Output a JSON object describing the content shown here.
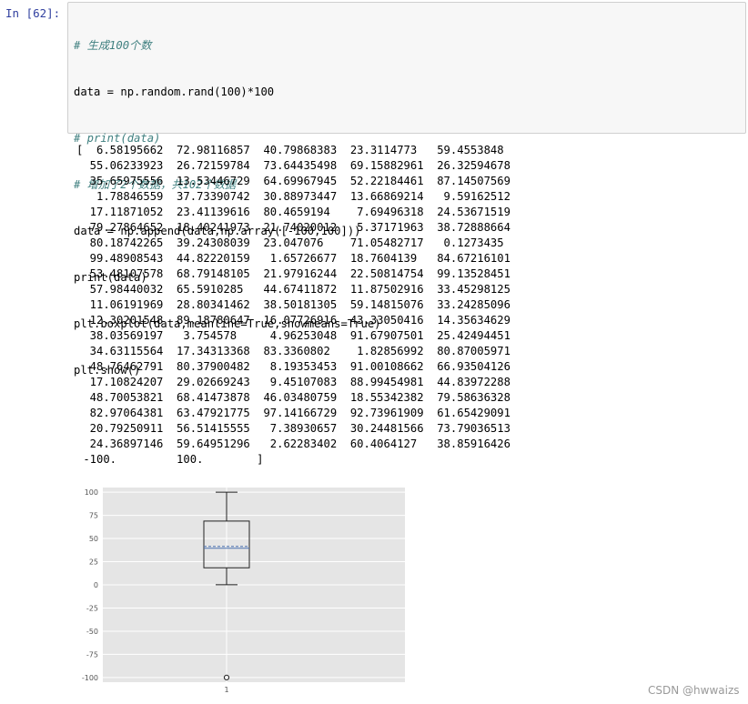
{
  "cell": {
    "prompt": "In  [62]:",
    "code_lines": [
      "# 生成100个数",
      "data = np.random.rand(100)*100",
      "# print(data)",
      "# 增加了2个数据，共102个数据",
      "data = np.append(data,np.array([-100,100]))",
      "print(data)",
      "plt.boxplot(data,meanline=True,showmeans=True)",
      "plt.show()"
    ]
  },
  "output": {
    "rows": [
      "[  6.58195662  72.98116857  40.79868383  23.3114773   59.4553848",
      "  55.06233923  26.72159784  73.64435498  69.15882961  26.32594678",
      "  35.65975556  13.53446729  64.69967945  52.22184461  87.14507569",
      "   1.78846559  37.73390742  30.88973447  13.66869214   9.59162512",
      "  17.11871052  23.41139616  80.4659194    7.69496318  24.53671519",
      "  79.27864652  18.40241973  21.74020012   5.37171963  38.72888664",
      "  80.18742265  39.24308039  23.047076    71.05482717   0.1273435",
      "  99.48908543  44.82220159   1.65726677  18.7604139   84.67216101",
      "  53.48107578  68.79148105  21.97916244  22.50814754  99.13528451",
      "  57.98440032  65.5910285   44.67411872  11.87502916  33.45298125",
      "  11.06191969  28.80341462  38.50181305  59.14815076  33.24285096",
      "  12.30201548  89.18780647  16.07726916  43.33050416  14.35634629",
      "  38.03569197   3.754578     4.96253048  91.67907501  25.42494451",
      "  34.63115564  17.34313368  83.3360802    1.82856992  80.87005971",
      "  48.76462791  80.37900482   8.19353453  91.00108662  66.93504126",
      "  17.10824207  29.02669243   9.45107083  88.99454981  44.83972288",
      "  48.70053821  68.41473878  46.03480759  18.55342382  79.58636328",
      "  82.97064381  63.47921775  97.14166729  92.73961909  61.65429091",
      "  20.79250911  56.51415555   7.38930657  30.24481566  73.79036513",
      "  24.36897146  59.64951296   2.62283402  60.4064127   38.85916426",
      " -100.         100.        ]"
    ]
  },
  "chart_data": {
    "type": "boxplot",
    "title": "",
    "xlabel": "",
    "ylabel": "",
    "categories": [
      "1"
    ],
    "ylim": [
      -105,
      105
    ],
    "yticks": [
      100,
      75,
      50,
      25,
      0,
      -25,
      -50,
      -75,
      -100
    ],
    "grid": true,
    "style": "ggplot",
    "boxes": [
      {
        "name": "1",
        "whisker_low": 0.13,
        "q1": 18.4,
        "median": 39.5,
        "mean": 41.5,
        "q3": 68.8,
        "whisker_high": 100,
        "outliers": [
          -100
        ]
      }
    ],
    "colors": {
      "background": "#e5e5e5",
      "grid": "#ffffff",
      "box": "#222222",
      "median": "#4c72b0",
      "mean_line": "#4c72b0"
    }
  },
  "watermark": "CSDN @hwwaizs"
}
